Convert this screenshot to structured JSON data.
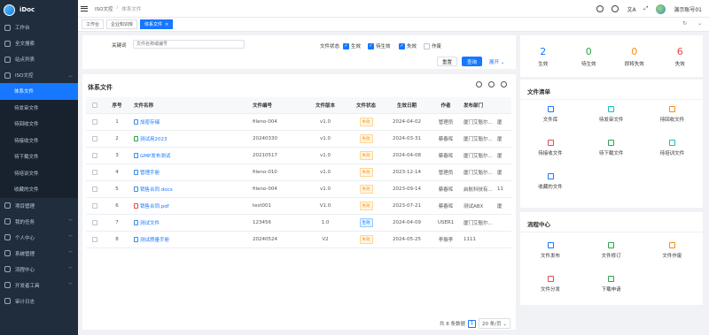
{
  "app": {
    "name": "iDoc"
  },
  "sidebar": {
    "items": [
      {
        "label": "工作台"
      },
      {
        "label": "全文搜索"
      },
      {
        "label": "站点列表"
      },
      {
        "label": "ISO文控"
      }
    ],
    "sub_items": [
      {
        "label": "体系文件",
        "active": true
      },
      {
        "label": "待发审文件"
      },
      {
        "label": "待回收文件"
      },
      {
        "label": "待接收文件"
      },
      {
        "label": "待下载文件"
      },
      {
        "label": "待培训文件"
      },
      {
        "label": "收藏的文件"
      }
    ],
    "items_after": [
      {
        "label": "项目管理"
      },
      {
        "label": "我的任务"
      },
      {
        "label": "个人中心"
      },
      {
        "label": "系统管理"
      },
      {
        "label": "流程中心"
      },
      {
        "label": "开发者工具"
      },
      {
        "label": "审计日志"
      }
    ]
  },
  "topbar": {
    "breadcrumb": [
      "ISO文控",
      "体系文件"
    ],
    "user_name": "演示账号01"
  },
  "tabs": [
    {
      "label": "工作台",
      "active": false
    },
    {
      "label": "企业知识库",
      "active": false
    },
    {
      "label": "体系文件",
      "active": true
    }
  ],
  "search": {
    "keyword_label": "关键词",
    "keyword_placeholder": "文件名称或编号",
    "status_label": "文件状态",
    "statuses": [
      {
        "label": "生效",
        "checked": true
      },
      {
        "label": "待生效",
        "checked": true
      },
      {
        "label": "失效",
        "checked": true
      },
      {
        "label": "作废",
        "checked": false
      }
    ],
    "reset_label": "重置",
    "query_label": "查询",
    "expand_label": "展开"
  },
  "table": {
    "title": "体系文件",
    "headers": [
      "序号",
      "文件名称",
      "文件编号",
      "文件版本",
      "文件状态",
      "生效日期",
      "作者",
      "发布部门"
    ],
    "rows": [
      {
        "no": "1",
        "name": "加密存储",
        "code": "fileno-004",
        "version": "v1.0",
        "status": "失效",
        "date": "2024-04-02",
        "author": "管理员",
        "dept": "厦门艾魁尔...",
        "more": "厦",
        "icon": "b"
      },
      {
        "no": "2",
        "name": "测试用2023",
        "code": "20240330",
        "version": "v1.0",
        "status": "失效",
        "date": "2024-03-31",
        "author": "蔡春晖",
        "dept": "厦门艾魁尔...",
        "more": "厦",
        "icon": "g"
      },
      {
        "no": "3",
        "name": "GMP发布测试",
        "code": "20210517",
        "version": "v1.0",
        "status": "失效",
        "date": "2024-04-08",
        "author": "蔡春晖",
        "dept": "厦门艾魁尔...",
        "more": "厦",
        "icon": "b"
      },
      {
        "no": "4",
        "name": "管理手册",
        "code": "fileno-010",
        "version": "v1.0",
        "status": "失效",
        "date": "2023-12-14",
        "author": "管理员",
        "dept": "厦门艾魁尔...",
        "more": "厦",
        "icon": "b"
      },
      {
        "no": "5",
        "name": "销售合同.docx",
        "code": "fileno-004",
        "version": "v1.0",
        "status": "失效",
        "date": "2023-09-14",
        "author": "蔡春晖",
        "dept": "启航科技有...",
        "more": "11",
        "icon": "b"
      },
      {
        "no": "6",
        "name": "销售合同.pdf",
        "code": "test001",
        "version": "V1.0",
        "status": "失效",
        "date": "2023-07-21",
        "author": "蔡春晖",
        "dept": "测试ABX",
        "more": "厦",
        "icon": "r"
      },
      {
        "no": "7",
        "name": "测试文件",
        "code": "123456",
        "version": "1.0",
        "status": "生效",
        "date": "2024-04-09",
        "author": "USER1",
        "dept": "厦门艾魁尔...",
        "more": "",
        "icon": "b"
      },
      {
        "no": "8",
        "name": "测试质量手册",
        "code": "20240524",
        "version": "V2",
        "status": "失效",
        "date": "2024-05-25",
        "author": "李振李",
        "dept": "1111",
        "more": "",
        "icon": "b"
      }
    ],
    "pager": {
      "total": "共 8 条数据",
      "page": "1",
      "size": "20 条/页"
    }
  },
  "stats": [
    {
      "num": "2",
      "label": "生效",
      "color": "#1677ff"
    },
    {
      "num": "0",
      "label": "待生效",
      "color": "#2da44e"
    },
    {
      "num": "0",
      "label": "即将失效",
      "color": "#fa8c16"
    },
    {
      "num": "6",
      "label": "失效",
      "color": "#e5484d"
    }
  ],
  "doc_list": {
    "title": "文件清单",
    "items": [
      {
        "label": "文件库",
        "color": "#1677ff"
      },
      {
        "label": "待发审文件",
        "color": "#13c2c2"
      },
      {
        "label": "待回收文件",
        "color": "#fa8c16"
      },
      {
        "label": "待接收文件",
        "color": "#e5484d"
      },
      {
        "label": "待下载文件",
        "color": "#2da44e"
      },
      {
        "label": "待培训文件",
        "color": "#13c2c2"
      },
      {
        "label": "收藏的文件",
        "color": "#1677ff"
      }
    ]
  },
  "flow": {
    "title": "流程中心",
    "items": [
      {
        "label": "文件发布",
        "color": "#1677ff"
      },
      {
        "label": "文件修订",
        "color": "#2da44e"
      },
      {
        "label": "文件作废",
        "color": "#fa8c16"
      },
      {
        "label": "文件分发",
        "color": "#e5484d"
      },
      {
        "label": "下载申请",
        "color": "#2da44e"
      }
    ]
  }
}
